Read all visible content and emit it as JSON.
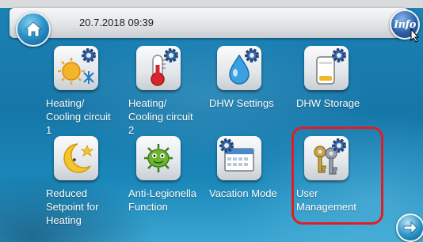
{
  "header": {
    "datetime": "20.7.2018 09:39",
    "info_label": "Info"
  },
  "tiles": [
    {
      "label": "Heating/\nCooling circuit\n1",
      "icon": "sun-snowflake-gear-icon"
    },
    {
      "label": "Heating/\nCooling circuit\n2",
      "icon": "thermometer-gear-icon"
    },
    {
      "label": "DHW Settings",
      "icon": "water-drop-gear-icon"
    },
    {
      "label": "DHW Storage",
      "icon": "storage-tank-gear-icon"
    },
    {
      "label": "Reduced\nSetpoint for\nHeating",
      "icon": "moon-star-icon"
    },
    {
      "label": "Anti-Legionella\nFunction",
      "icon": "bacteria-icon"
    },
    {
      "label": "Vacation Mode",
      "icon": "calendar-gear-icon"
    },
    {
      "label": "User\nManagement",
      "icon": "keys-gear-icon"
    }
  ],
  "colors": {
    "highlight": "#e01d25",
    "label_text": "#ffffff",
    "background": "#1676a8"
  }
}
